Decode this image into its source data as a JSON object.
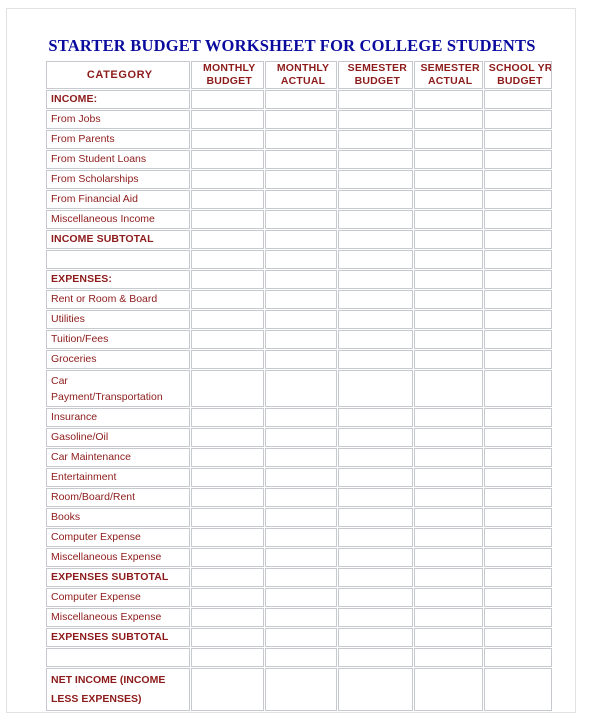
{
  "document": {
    "title": "STARTER BUDGET WORKSHEET FOR COLLEGE STUDENTS",
    "title_color": "#0a0a9e",
    "text_color": "#8d1b1b",
    "border_color": "#c6c9ce"
  },
  "table": {
    "columns": [
      {
        "id": "category",
        "line1": "CATEGORY",
        "line2": ""
      },
      {
        "id": "monthly_budget",
        "line1": "MONTHLY",
        "line2": "BUDGET"
      },
      {
        "id": "monthly_actual",
        "line1": "MONTHLY",
        "line2": "ACTUAL"
      },
      {
        "id": "semester_budget",
        "line1": "SEMESTER",
        "line2": "BUDGET"
      },
      {
        "id": "semester_actual",
        "line1": "SEMESTER",
        "line2": "ACTUAL"
      },
      {
        "id": "school_yr_budget",
        "line1": "SCHOOL YR",
        "line2": "BUDGET"
      }
    ],
    "rows": [
      {
        "type": "section",
        "label": "INCOME:"
      },
      {
        "type": "item",
        "label": "From Jobs"
      },
      {
        "type": "item",
        "label": "From Parents"
      },
      {
        "type": "item",
        "label": "From Student Loans"
      },
      {
        "type": "item",
        "label": "From Scholarships"
      },
      {
        "type": "item",
        "label": "From Financial Aid"
      },
      {
        "type": "item",
        "label": "Miscellaneous Income"
      },
      {
        "type": "subtotal",
        "label": "INCOME SUBTOTAL"
      },
      {
        "type": "spacer",
        "label": ""
      },
      {
        "type": "section",
        "label": "EXPENSES:"
      },
      {
        "type": "item",
        "label": "Rent or Room & Board"
      },
      {
        "type": "item",
        "label": "Utilities"
      },
      {
        "type": "item",
        "label": "Tuition/Fees"
      },
      {
        "type": "item",
        "label": "Groceries"
      },
      {
        "type": "item2",
        "label": "Car Payment/Transportation",
        "line1": "Car",
        "line2": "Payment/Transportation"
      },
      {
        "type": "item",
        "label": "Insurance"
      },
      {
        "type": "item",
        "label": "Gasoline/Oil"
      },
      {
        "type": "item",
        "label": "Car Maintenance"
      },
      {
        "type": "item",
        "label": "Entertainment"
      },
      {
        "type": "item",
        "label": "Room/Board/Rent"
      },
      {
        "type": "item",
        "label": "Books"
      },
      {
        "type": "item",
        "label": "Computer Expense"
      },
      {
        "type": "item",
        "label": "Miscellaneous Expense"
      },
      {
        "type": "subtotal",
        "label": "EXPENSES SUBTOTAL"
      },
      {
        "type": "item",
        "label": "Computer Expense"
      },
      {
        "type": "item",
        "label": "Miscellaneous Expense"
      },
      {
        "type": "subtotal",
        "label": "EXPENSES SUBTOTAL"
      },
      {
        "type": "spacer",
        "label": ""
      },
      {
        "type": "net",
        "label": "NET INCOME (INCOME LESS EXPENSES)",
        "line1": "NET INCOME (INCOME",
        "line2": "LESS EXPENSES)"
      }
    ],
    "cell_value": ""
  }
}
